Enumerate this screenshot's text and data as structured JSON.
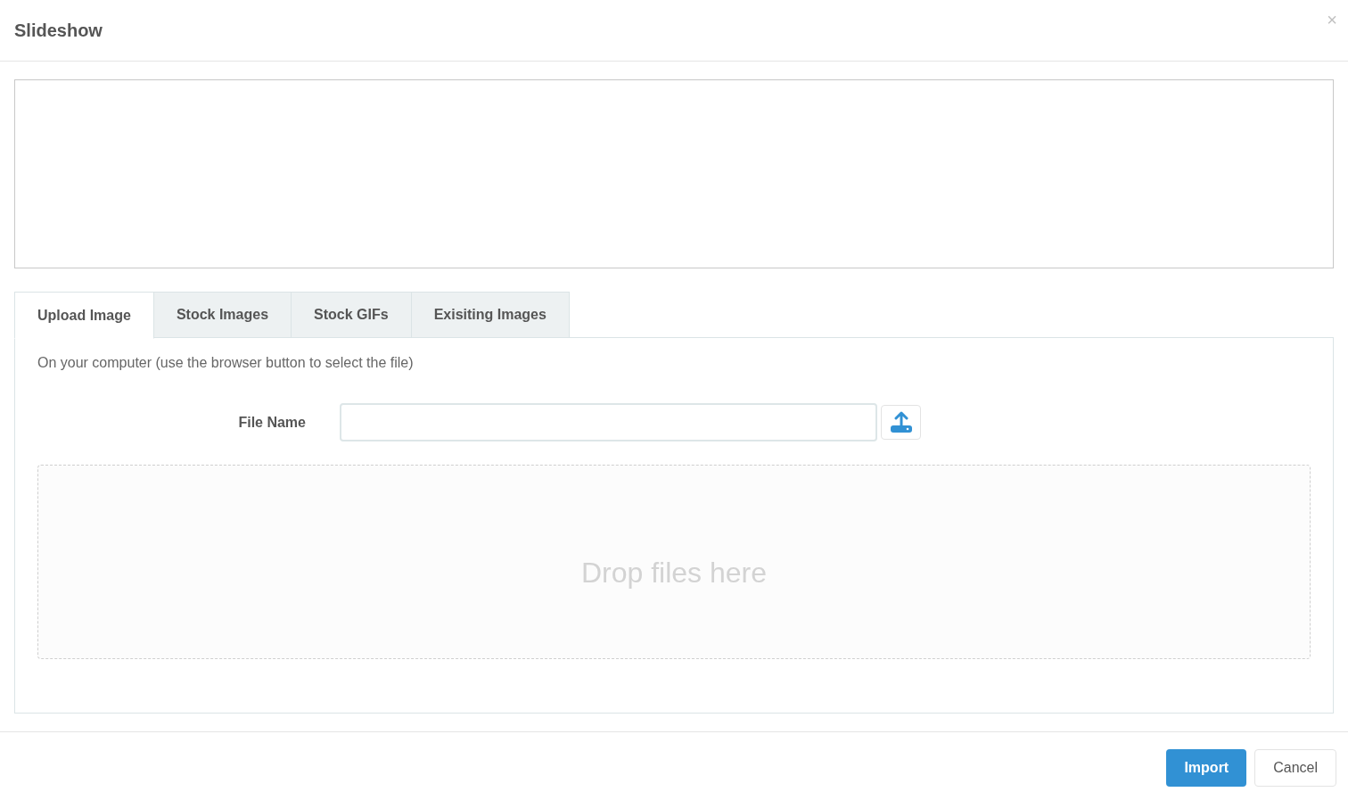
{
  "dialog": {
    "title": "Slideshow",
    "close": "×"
  },
  "tabs": [
    {
      "label": "Upload Image",
      "selected": true
    },
    {
      "label": "Stock Images",
      "selected": false
    },
    {
      "label": "Stock GIFs",
      "selected": false
    },
    {
      "label": "Exisiting Images",
      "selected": false
    }
  ],
  "upload": {
    "description": "On your computer (use the browser button to select the file)",
    "file_label": "File Name",
    "dropzone": "Drop files here"
  },
  "buttons": [
    {
      "label": "Import",
      "kind": "primary"
    },
    {
      "label": "Cancel",
      "kind": "secondary"
    }
  ]
}
